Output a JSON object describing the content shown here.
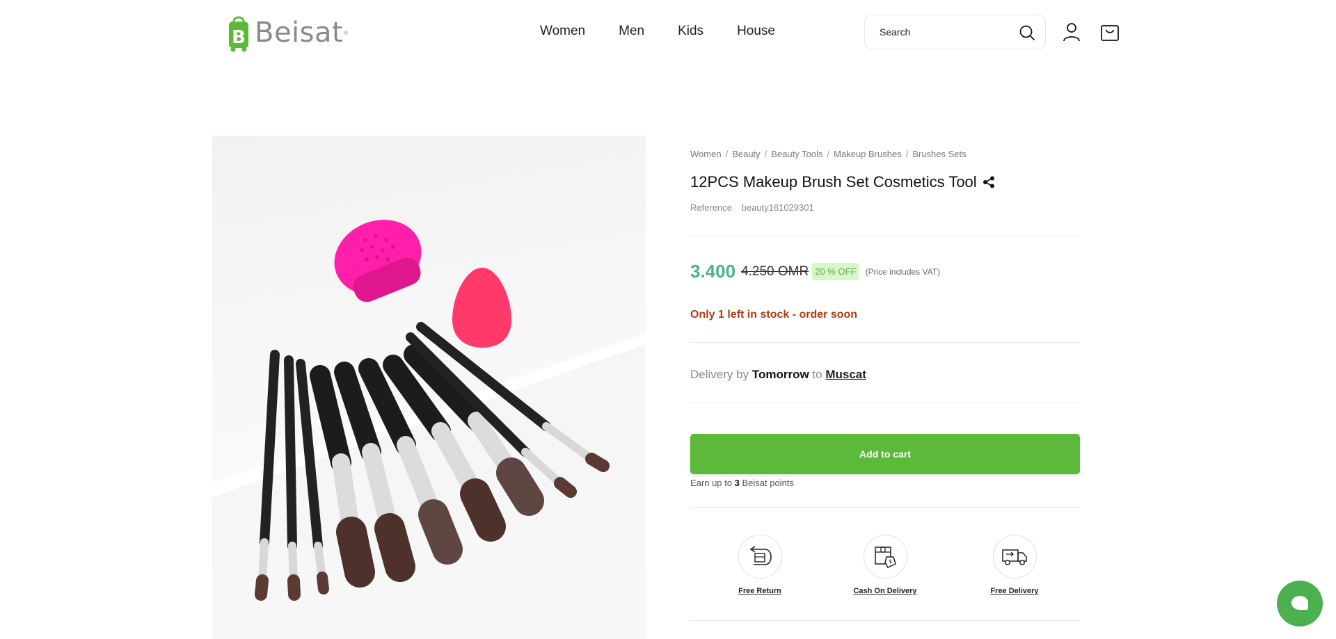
{
  "header": {
    "brand": "Beisat",
    "nav": [
      "Women",
      "Men",
      "Kids",
      "House"
    ],
    "search_placeholder": "Search"
  },
  "breadcrumb": [
    "Women",
    "Beauty",
    "Beauty Tools",
    "Makeup Brushes",
    "Brushes Sets"
  ],
  "product": {
    "title": "12PCS Makeup Brush Set Cosmetics Tool",
    "reference_label": "Reference",
    "reference_value": "beauty161029301",
    "price": "3.400",
    "old_price": "4.250 OMR",
    "discount": "20 % OFF",
    "vat_note": "(Price includes VAT)",
    "stock_note": "Only 1 left in stock - order soon",
    "delivery_prefix": "Delivery by",
    "delivery_day": "Tomorrow",
    "delivery_to": "to",
    "delivery_city": "Muscat",
    "cta_label": "Add to cart",
    "points_prefix": "Earn up to",
    "points_value": "3",
    "points_suffix": "Beisat points"
  },
  "features": [
    {
      "label": "Free Return",
      "icon": "return-box-icon"
    },
    {
      "label": "Cash On Delivery",
      "icon": "cash-delivery-icon"
    },
    {
      "label": "Free Delivery",
      "icon": "delivery-truck-icon"
    }
  ],
  "colors": {
    "brand_green": "#5cb93a",
    "price_green": "#4cb38a",
    "stock_red": "#b13a12",
    "chat_green": "#4caf50"
  }
}
